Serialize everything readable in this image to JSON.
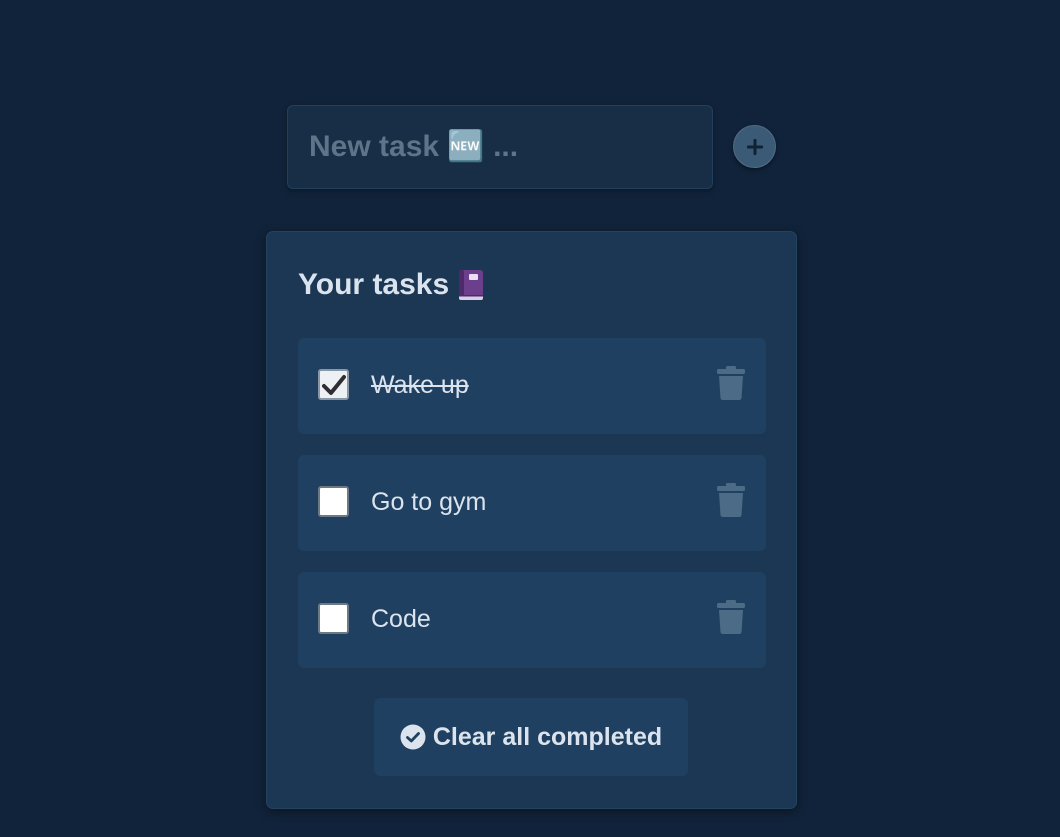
{
  "new_task": {
    "placeholder": "New task 🆕 ...",
    "badge_text": "NEW"
  },
  "add_button": {
    "icon": "plus-icon"
  },
  "panel": {
    "title": "Your tasks",
    "title_icon": "notebook-icon",
    "tasks": [
      {
        "label": "Wake up",
        "completed": true
      },
      {
        "label": "Go to gym",
        "completed": false
      },
      {
        "label": "Code",
        "completed": false
      }
    ],
    "clear_button_label": "Clear all completed",
    "clear_button_icon": "check-circle-icon"
  },
  "colors": {
    "background": "#11233a",
    "panel": "#1b3753",
    "row": "#1f4060",
    "text": "#dbe4ee",
    "placeholder": "#5d7489",
    "trash": "#4b6b87"
  }
}
